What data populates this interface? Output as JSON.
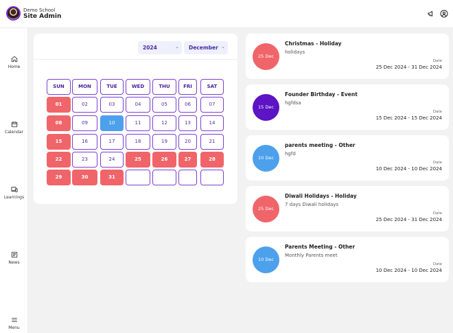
{
  "header": {
    "school_name": "Demo School",
    "admin_name": "Site Admin",
    "icons": [
      "megaphone-icon",
      "user-circle-icon"
    ]
  },
  "sidebar": {
    "items": [
      {
        "label": "Home",
        "icon": "home-icon"
      },
      {
        "label": "Calendar",
        "icon": "calendar-icon"
      },
      {
        "label": "Learnings",
        "icon": "devices-icon"
      },
      {
        "label": "News",
        "icon": "news-icon"
      },
      {
        "label": "Menu",
        "icon": "menu-icon"
      }
    ]
  },
  "calendar": {
    "year": "2024",
    "month": "December",
    "weekdays": [
      "SUN",
      "MON",
      "TUE",
      "WED",
      "THU",
      "FRI",
      "SAT"
    ],
    "days": [
      [
        "01",
        "02",
        "03",
        "04",
        "05",
        "06",
        "07"
      ],
      [
        "08",
        "09",
        "10",
        "11",
        "12",
        "13",
        "14"
      ],
      [
        "15",
        "16",
        "17",
        "18",
        "19",
        "20",
        "21"
      ],
      [
        "22",
        "23",
        "24",
        "25",
        "26",
        "27",
        "28"
      ],
      [
        "29",
        "30",
        "31",
        "",
        "",
        "",
        ""
      ]
    ],
    "holiday_days": [
      "01",
      "08",
      "15",
      "22",
      "25",
      "26",
      "27",
      "28",
      "29",
      "30",
      "31"
    ],
    "today": "10",
    "colors": {
      "holiday": "#f0656a",
      "today": "#4da0ec",
      "accent": "#7b3fd0"
    }
  },
  "events": [
    {
      "badge": "25 Dec",
      "color": "#f0656a",
      "title": "Christmas - Holiday",
      "desc": "holidays",
      "date_label": "Date",
      "dates": "25 Dec 2024 - 31 Dec 2024"
    },
    {
      "badge": "15 Dec",
      "color": "#5c14c4",
      "title": "Founder Birthday - Event",
      "desc": "hgfdsa",
      "date_label": "Date",
      "dates": "15 Dec 2024 - 15 Dec 2024"
    },
    {
      "badge": "10 Dec",
      "color": "#4da0ec",
      "title": "parents meeting - Other",
      "desc": "hgfd",
      "date_label": "Date",
      "dates": "10 Dec 2024 - 10 Dec 2024"
    },
    {
      "badge": "25 Dec",
      "color": "#f0656a",
      "title": "Diwali Holidays - Holiday",
      "desc": "7 days Diwali holidays",
      "date_label": "Date",
      "dates": "25 Dec 2024 - 31 Dec 2024"
    },
    {
      "badge": "10 Dec",
      "color": "#4da0ec",
      "title": "Parents Meeting - Other",
      "desc": "Monthly Parents meet",
      "date_label": "Date",
      "dates": "10 Dec 2024 - 10 Dec 2024"
    }
  ]
}
